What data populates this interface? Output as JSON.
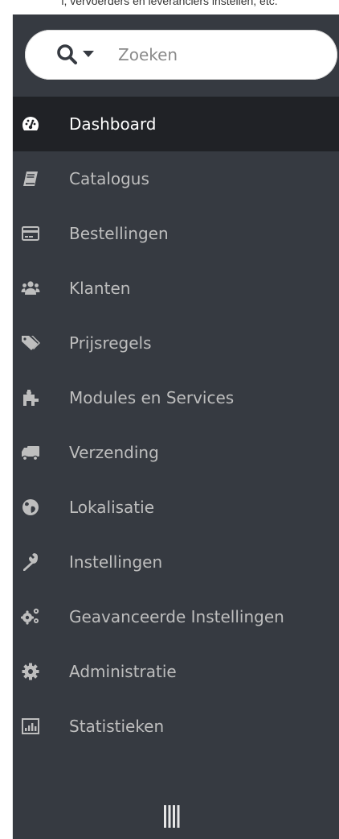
{
  "caption": "l, vervoerders en leveranciers instellen, etc.",
  "search": {
    "placeholder": "Zoeken",
    "icon": "search-icon",
    "dropdown_icon": "caret-down-icon"
  },
  "menu": [
    {
      "label": "Dashboard",
      "icon": "tachometer-icon",
      "active": true
    },
    {
      "label": "Catalogus",
      "icon": "book-icon",
      "active": false
    },
    {
      "label": "Bestellingen",
      "icon": "credit-card-icon",
      "active": false
    },
    {
      "label": "Klanten",
      "icon": "users-icon",
      "active": false
    },
    {
      "label": "Prijsregels",
      "icon": "tags-icon",
      "active": false
    },
    {
      "label": "Modules en Services",
      "icon": "puzzle-icon",
      "active": false
    },
    {
      "label": "Verzending",
      "icon": "truck-icon",
      "active": false
    },
    {
      "label": "Lokalisatie",
      "icon": "globe-icon",
      "active": false
    },
    {
      "label": "Instellingen",
      "icon": "wrench-icon",
      "active": false
    },
    {
      "label": "Geavanceerde Instellingen",
      "icon": "cogs-icon",
      "active": false
    },
    {
      "label": "Administratie",
      "icon": "cog-icon",
      "active": false
    },
    {
      "label": "Statistieken",
      "icon": "bar-chart-icon",
      "active": false
    }
  ],
  "collapse_icon": "collapse-bars-icon",
  "colors": {
    "sidebar_bg": "#363a41",
    "active_bg": "#202226",
    "icon_color": "#bebebe",
    "active_icon_color": "#ffffff"
  }
}
